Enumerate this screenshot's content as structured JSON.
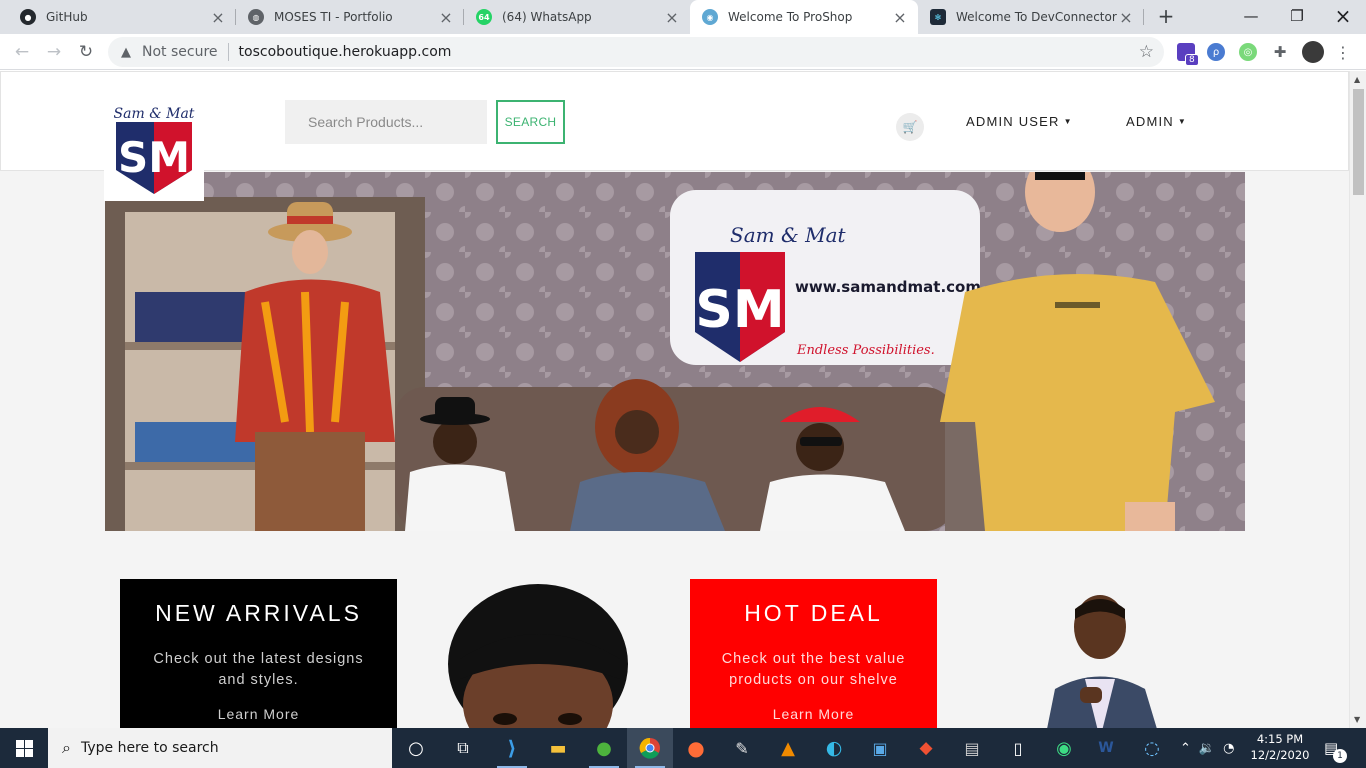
{
  "browser": {
    "tabs": [
      {
        "title": "GitHub",
        "icon": "github-icon",
        "active": false
      },
      {
        "title": "MOSES TI - Portfolio",
        "icon": "globe-icon",
        "active": false
      },
      {
        "title": "(64) WhatsApp",
        "icon": "whatsapp-icon",
        "badge": "64",
        "active": false
      },
      {
        "title": "Welcome To ProShop",
        "icon": "proshop-icon",
        "active": true
      },
      {
        "title": "Welcome To DevConnector",
        "icon": "react-icon",
        "active": false
      }
    ],
    "security_label": "Not secure",
    "url": "toscoboutique.herokuapp.com",
    "extension_badge": "8"
  },
  "site": {
    "logo_text_top": "Sam & Mat",
    "logo_monogram": "SM",
    "search": {
      "placeholder": "Search Products...",
      "button_label": "SEARCH"
    },
    "nav": {
      "user_menu": "ADMIN USER",
      "admin_menu": "ADMIN"
    }
  },
  "hero": {
    "sign_script": "Sam & Mat",
    "sign_monogram": "SM",
    "sign_url": "www.samandmat.com",
    "sign_tagline": "Endless Possibilities."
  },
  "promos": [
    {
      "heading": "NEW ARRIVALS",
      "text": "Check out the latest designs and styles.",
      "link": "Learn More"
    },
    {
      "heading": "HOT DEAL",
      "text": "Check out the best value products on our shelve",
      "link": "Learn More"
    }
  ],
  "taskbar": {
    "search_placeholder": "Type here to search",
    "time": "4:15 PM",
    "date": "12/2/2020",
    "notification_count": "1"
  },
  "colors": {
    "accent_green": "#3cb371",
    "promo_dark": "#000000",
    "promo_red": "#ff0000",
    "brand_navy": "#1f2d6b",
    "brand_red": "#d0122c"
  }
}
